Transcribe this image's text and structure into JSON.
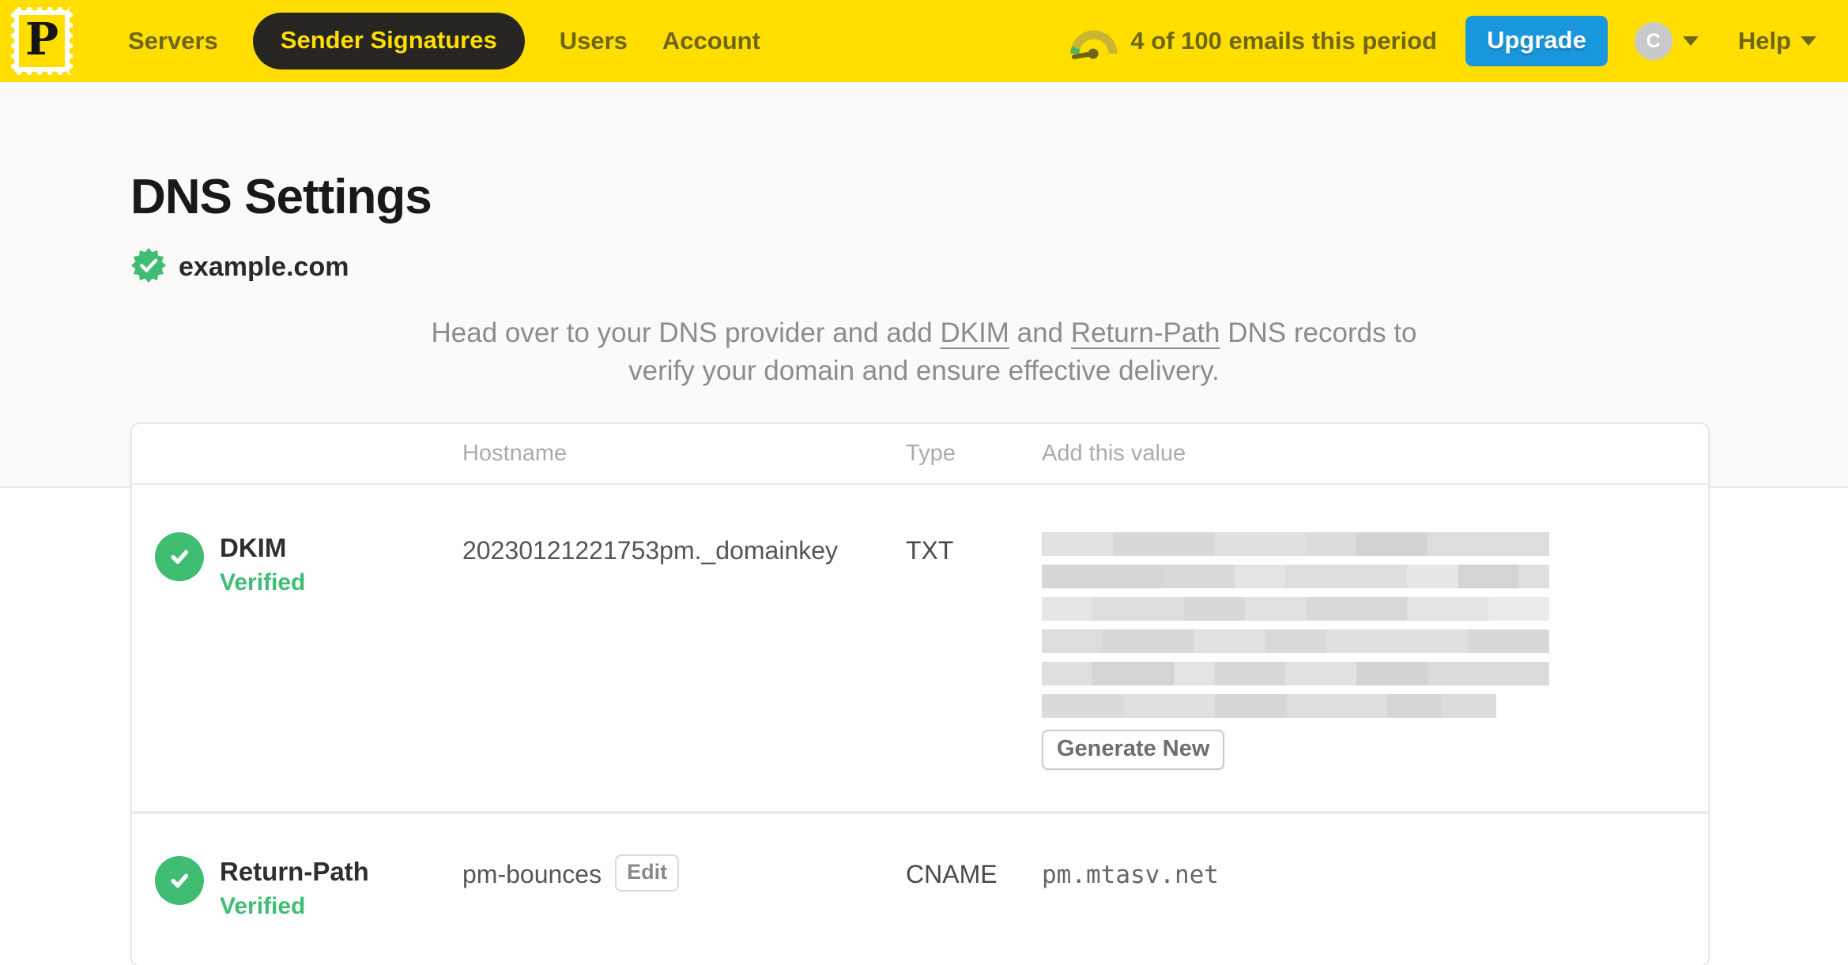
{
  "colors": {
    "brand_yellow": "#FFDE00",
    "nav_text_olive": "#6F6519",
    "active_pill_dark": "#262522",
    "upgrade_blue": "#1897DE",
    "success_green": "#3EBD73",
    "avatar_gray": "#C9C9C9"
  },
  "icons": {
    "logo": "postmark-stamp-logo",
    "usage": "usage-gauge-icon",
    "domain_badge": "verified-seal-icon",
    "row_status": "check-circle-icon",
    "menus": "chevron-down-icon"
  },
  "topbar": {
    "logo_letter": "P",
    "nav": {
      "items": [
        {
          "label": "Servers",
          "active": false
        },
        {
          "label": "Sender Signatures",
          "active": true
        },
        {
          "label": "Users",
          "active": false
        },
        {
          "label": "Account",
          "active": false
        }
      ]
    },
    "usage_text": "4 of 100 emails this period",
    "upgrade_label": "Upgrade",
    "avatar_initial": "C",
    "help_label": "Help"
  },
  "page": {
    "title": "DNS Settings",
    "domain": "example.com",
    "intro": {
      "pre": "Head over to your DNS provider and add ",
      "dkim_link": "DKIM",
      "and": " and ",
      "return_path_link": "Return-Path",
      "post": " DNS records to",
      "line2": "verify your domain and ensure effective delivery."
    }
  },
  "table": {
    "headers": {
      "hostname": "Hostname",
      "type": "Type",
      "value": "Add this value"
    },
    "rows": [
      {
        "name": "DKIM",
        "status": "Verified",
        "hostname": "20230121221753pm._domainkey",
        "type": "TXT",
        "value_redacted": true,
        "redacted_lines": 6,
        "action_label": "Generate New"
      },
      {
        "name": "Return-Path",
        "status": "Verified",
        "hostname": "pm-bounces",
        "edit_label": "Edit",
        "type": "CNAME",
        "value": "pm.mtasv.net"
      }
    ]
  }
}
